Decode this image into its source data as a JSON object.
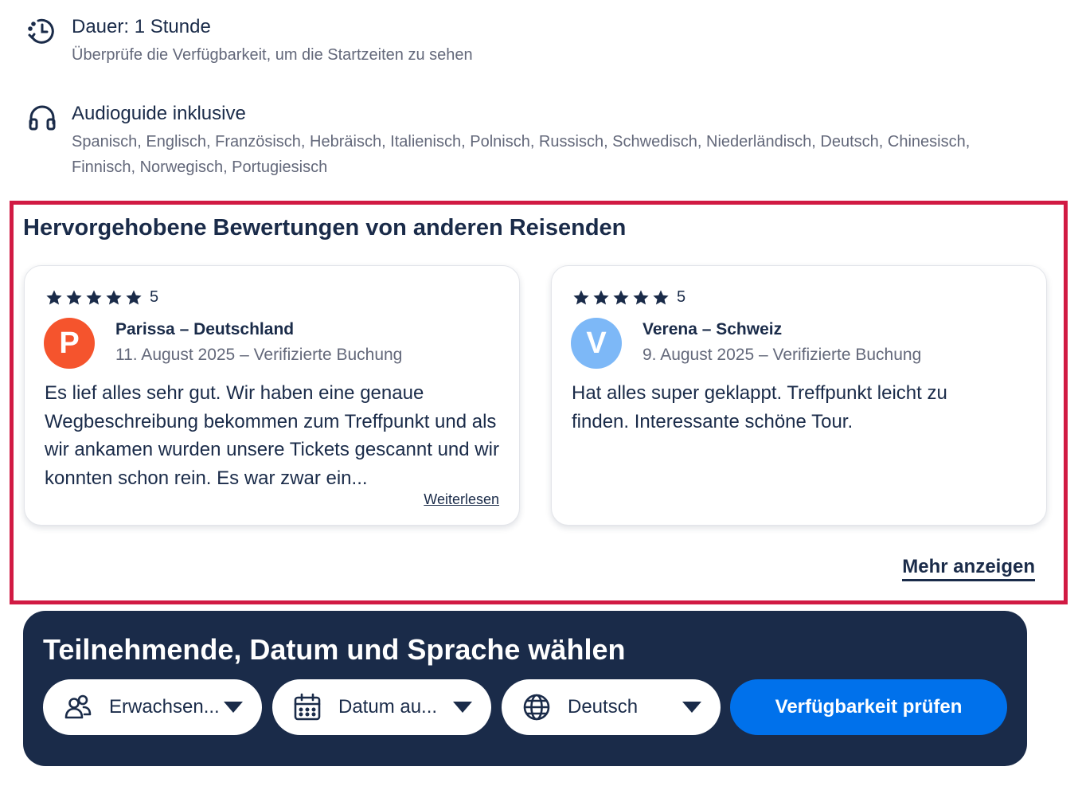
{
  "features": [
    {
      "icon": "clock-history-icon",
      "title": "Dauer: 1 Stunde",
      "description": "Überprüfe die Verfügbarkeit, um die Startzeiten zu sehen"
    },
    {
      "icon": "headphones-icon",
      "title": "Audioguide inklusive",
      "description": "Spanisch, Englisch, Französisch, Hebräisch, Italienisch, Polnisch, Russisch, Schwedisch, Niederländisch, Deutsch, Chinesisch, Finnisch, Norwegisch, Portugiesisch"
    }
  ],
  "reviews_section": {
    "title": "Hervorgehobene Bewertungen von anderen Reisenden",
    "more_label": "Mehr anzeigen",
    "highlight_color": "#d11a43",
    "reviews": [
      {
        "rating": 5,
        "rating_label": "5",
        "avatar_letter": "P",
        "avatar_color": "#f5542d",
        "author": "Parissa – Deutschland",
        "meta": "11. August 2025 – Verifizierte Buchung",
        "text": "Es lief alles sehr gut. Wir haben eine genaue Wegbeschreibung bekommen zum Treffpunkt und als wir ankamen wurden unsere Tickets gescannt und wir konnten schon rein. Es war zwar ein...",
        "read_more": "Weiterlesen"
      },
      {
        "rating": 5,
        "rating_label": "5",
        "avatar_letter": "V",
        "avatar_color": "#7db8f7",
        "author": "Verena – Schweiz",
        "meta": "9. August 2025 – Verifizierte Buchung",
        "text": "Hat alles super geklappt. Treffpunkt leicht zu finden. Interessante schöne Tour.",
        "read_more": ""
      }
    ]
  },
  "booking": {
    "title": "Teilnehmende, Datum und Sprache wählen",
    "background": "#1a2b49",
    "participants": {
      "icon": "people-icon",
      "label": "Erwachsen..."
    },
    "date": {
      "icon": "calendar-icon",
      "label": "Datum au..."
    },
    "language": {
      "icon": "globe-icon",
      "label": "Deutsch"
    },
    "cta_label": "Verfügbarkeit prüfen",
    "cta_color": "#0071eb"
  }
}
